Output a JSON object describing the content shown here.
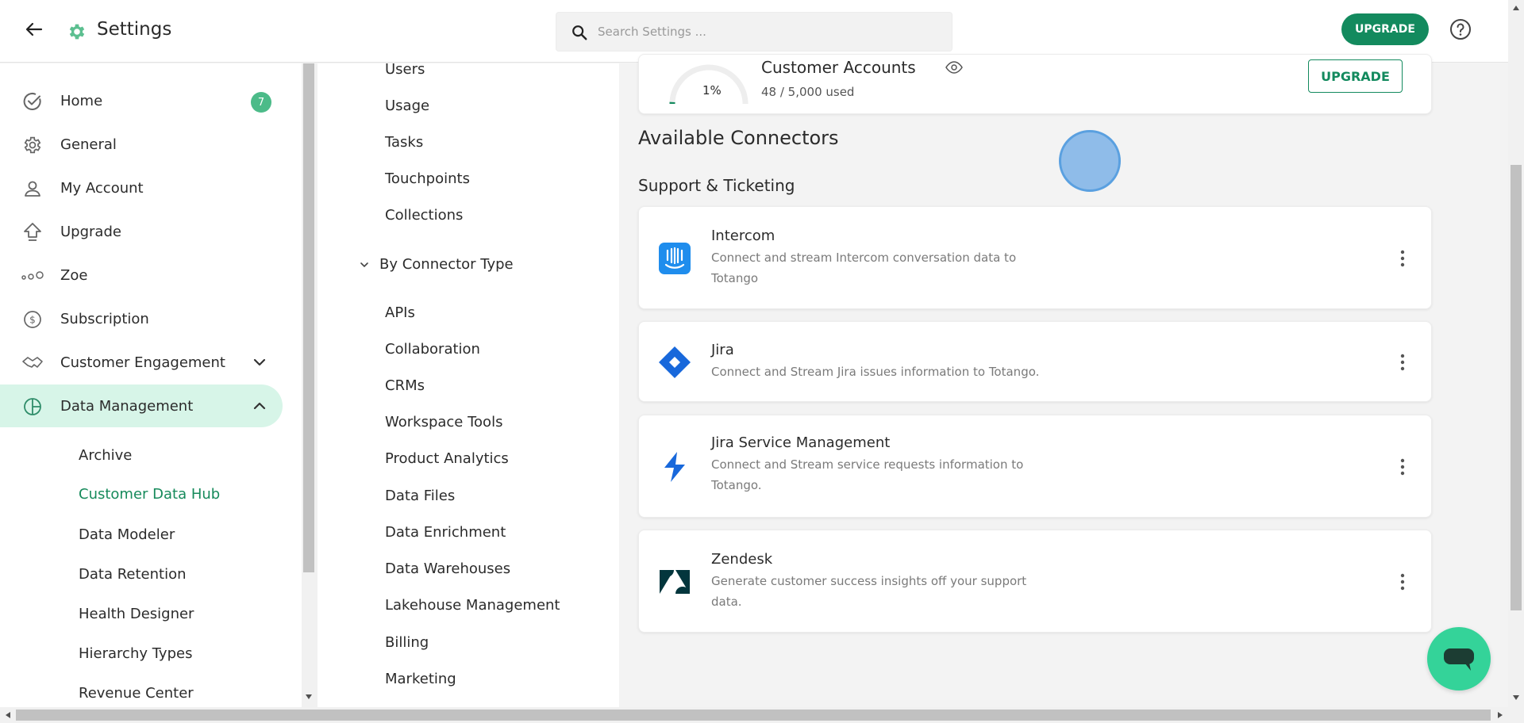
{
  "header": {
    "title": "Settings",
    "search_placeholder": "Search Settings ...",
    "upgrade_label": "UPGRADE",
    "accent": "#138a5e"
  },
  "sidebar": {
    "items": [
      {
        "label": "Home",
        "icon": "check-circle-icon",
        "badge": "7"
      },
      {
        "label": "General",
        "icon": "gear-icon"
      },
      {
        "label": "My Account",
        "icon": "user-icon"
      },
      {
        "label": "Upgrade",
        "icon": "upgrade-arrow-icon"
      },
      {
        "label": "Zoe",
        "icon": "dots-icon"
      },
      {
        "label": "Subscription",
        "icon": "dollar-icon"
      },
      {
        "label": "Customer Engagement",
        "icon": "handshake-icon"
      },
      {
        "label": "Data Management",
        "icon": "pie-icon"
      }
    ],
    "sub_items": [
      "Archive",
      "Customer Data Hub",
      "Data Modeler",
      "Data Retention",
      "Health Designer",
      "Hierarchy Types",
      "Revenue Center"
    ]
  },
  "filters": {
    "items_top": [
      "Users",
      "Usage",
      "Tasks",
      "Touchpoints",
      "Collections"
    ],
    "group_label": "By Connector Type",
    "items": [
      "APIs",
      "Collaboration",
      "CRMs",
      "Workspace Tools",
      "Product Analytics",
      "Data Files",
      "Data Enrichment",
      "Data Warehouses",
      "Lakehouse Management",
      "Billing",
      "Marketing"
    ]
  },
  "usage": {
    "percent": "1%",
    "percent_value": 1,
    "title": "Customer Accounts",
    "subtitle": "48 / 5,000 used",
    "upgrade_label": "UPGRADE"
  },
  "main": {
    "section_title": "Available Connectors",
    "category": "Support & Ticketing",
    "connectors": [
      {
        "name": "Intercom",
        "description": "Connect and stream Intercom conversation data to Totango",
        "icon": "intercom-logo-icon"
      },
      {
        "name": "Jira",
        "description": "Connect and Stream Jira issues information to Totango.",
        "icon": "jira-logo-icon"
      },
      {
        "name": "Jira Service Management",
        "description": "Connect and Stream service requests information to Totango.",
        "icon": "jira-service-management-logo-icon"
      },
      {
        "name": "Zendesk",
        "description": "Generate customer success insights off your support data.",
        "icon": "zendesk-logo-icon"
      }
    ]
  }
}
